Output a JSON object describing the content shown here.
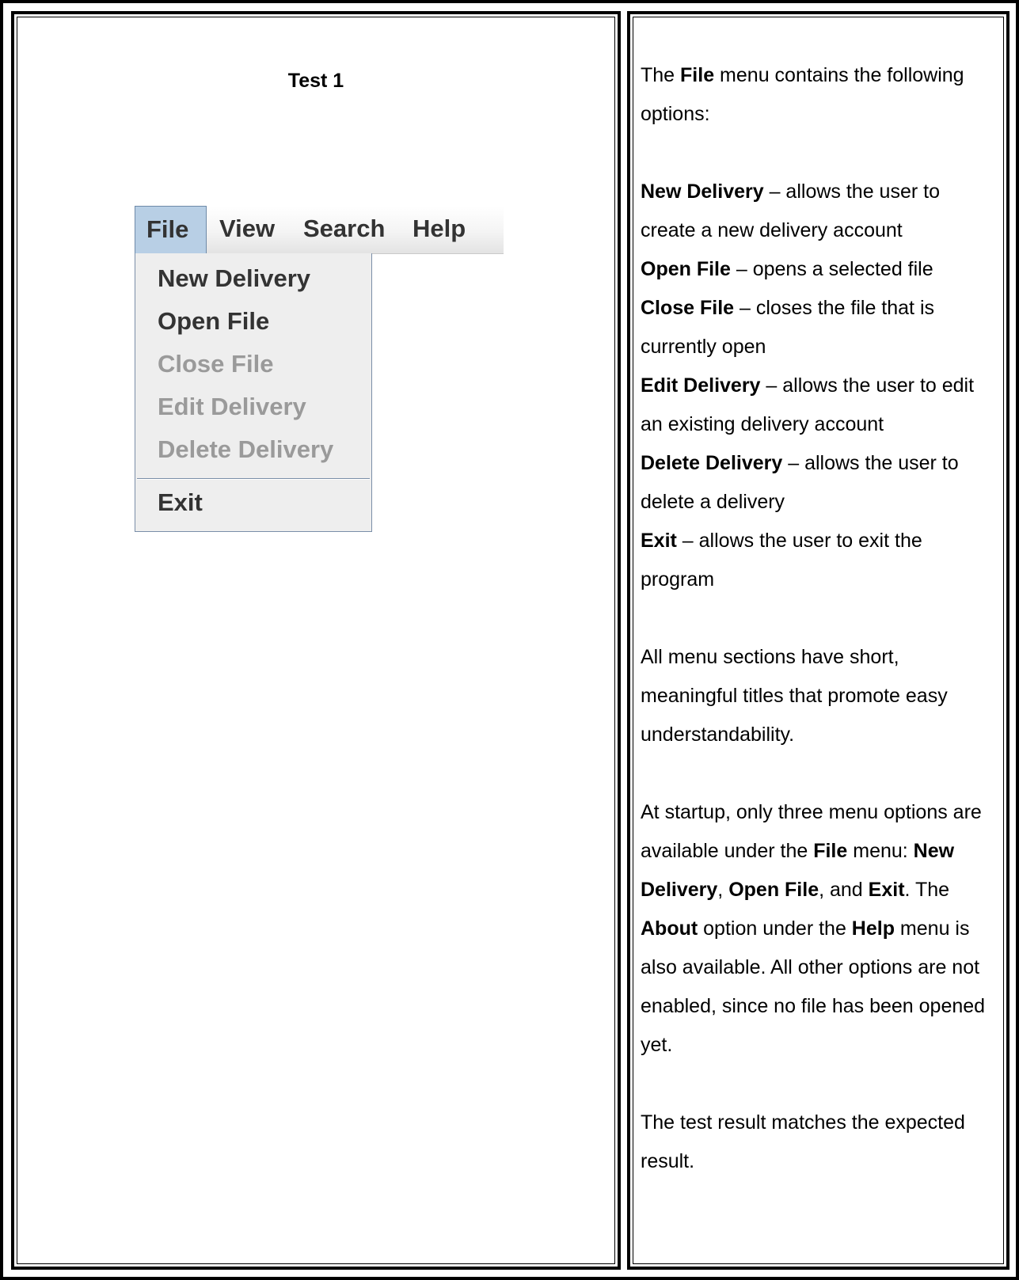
{
  "test_title": "Test 1",
  "menubar": {
    "items": [
      {
        "label": "File",
        "active": true
      },
      {
        "label": "View",
        "active": false
      },
      {
        "label": "Search",
        "active": false
      },
      {
        "label": "Help",
        "active": false
      }
    ]
  },
  "file_menu": {
    "options": [
      {
        "label": "New Delivery",
        "enabled": true
      },
      {
        "label": "Open File",
        "enabled": true
      },
      {
        "label": "Close File",
        "enabled": false
      },
      {
        "label": "Edit Delivery",
        "enabled": false
      },
      {
        "label": "Delete Delivery",
        "enabled": false
      },
      {
        "label": "Exit",
        "enabled": true
      }
    ]
  },
  "description": {
    "intro_1": "The ",
    "intro_bold": "File",
    "intro_2": " menu contains the following options:",
    "items": [
      {
        "term": "New Delivery",
        "text": " – allows the user to create a new delivery account"
      },
      {
        "term": "Open File",
        "text": " – opens a selected file"
      },
      {
        "term": "Close File",
        "text": " – closes the file that is currently open"
      },
      {
        "term": "Edit Delivery",
        "text": " – allows the user to edit an existing delivery account"
      },
      {
        "term": "Delete Delivery",
        "text": " – allows the user to delete a delivery"
      },
      {
        "term": "Exit",
        "text": " – allows the user to exit the program"
      }
    ],
    "para_titles": "All menu sections have short, meaningful titles that promote easy understandability.",
    "startup": {
      "t1": "At startup, only three menu options are available under the ",
      "b1": "File",
      "t2": " menu: ",
      "b2": "New Delivery",
      "t3": ", ",
      "b3": "Open File",
      "t4": ", and ",
      "b4": "Exit",
      "t5": ". The ",
      "b5": "About",
      "t6": " option under the ",
      "b6": "Help",
      "t7": " menu is also available. All other options are not enabled, since no file has been opened yet."
    },
    "result": "The test result matches the expected result."
  }
}
